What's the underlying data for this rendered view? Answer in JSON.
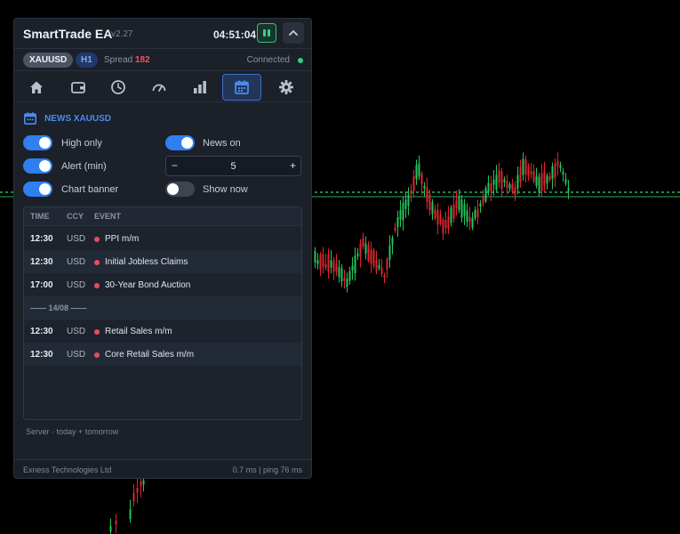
{
  "header": {
    "title": "SmartTrade EA",
    "version": "v2.27",
    "clock": "04:51:04"
  },
  "status": {
    "symbol": "XAUUSD",
    "timeframe": "H1",
    "spread_label": "Spread",
    "spread_value": "182",
    "connection": "Connected"
  },
  "tabs": [
    {
      "icon": "home-icon"
    },
    {
      "icon": "wallet-icon"
    },
    {
      "icon": "clock-icon"
    },
    {
      "icon": "gauge-icon"
    },
    {
      "icon": "bar-chart-icon"
    },
    {
      "icon": "calendar-icon",
      "active": true
    },
    {
      "icon": "gear-icon"
    }
  ],
  "news": {
    "title": "NEWS XAUUSD",
    "toggles": {
      "high_only": {
        "label": "High only",
        "on": true
      },
      "news_on": {
        "label": "News on",
        "on": true
      },
      "alert_min": {
        "label": "Alert (min)",
        "on": true
      },
      "chart_banner": {
        "label": "Chart banner",
        "on": true
      },
      "show_now": {
        "label": "Show now",
        "on": false
      }
    },
    "alert_stepper": {
      "minus": "−",
      "value": "5",
      "plus": "+"
    },
    "columns": {
      "time": "TIME",
      "ccy": "CCY",
      "event": "EVENT"
    },
    "rows": [
      {
        "time": "12:30",
        "ccy": "USD",
        "event": "PPI m/m"
      },
      {
        "time": "12:30",
        "ccy": "USD",
        "event": "Initial Jobless Claims"
      },
      {
        "time": "17:00",
        "ccy": "USD",
        "event": "30-Year Bond Auction"
      },
      {
        "separator": "—— 14/08 ——"
      },
      {
        "time": "12:30",
        "ccy": "USD",
        "event": "Retail Sales m/m"
      },
      {
        "time": "12:30",
        "ccy": "USD",
        "event": "Core Retail Sales m/m"
      }
    ],
    "footnote": "Server  ·  today + tomorrow"
  },
  "footer": {
    "broker": "Exness Technologies Ltd",
    "stats": "0.7 ms  |  ping 76 ms"
  },
  "colors": {
    "accent": "#2f7ff0",
    "bull": "#22c55e",
    "bear": "#e0242f",
    "impact_high": "#e84c5f",
    "connected": "#2fd07a"
  }
}
